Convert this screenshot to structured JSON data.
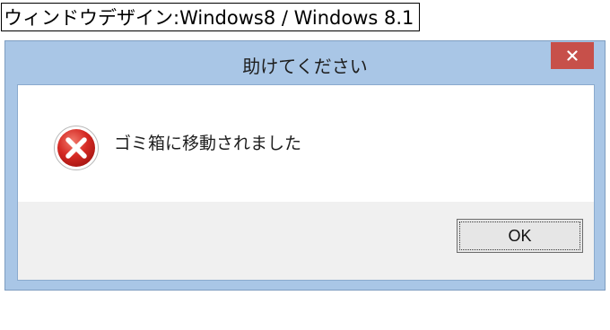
{
  "caption": "ウィンドウデザイン:Windows8 / Windows 8.1",
  "dialog": {
    "title": "助けてください",
    "message": "ゴミ箱に移動されました",
    "ok_label": "OK",
    "icons": {
      "close": "close-icon",
      "status": "error-icon"
    },
    "colors": {
      "frame": "#a9c6e6",
      "close_button": "#c7504a",
      "footer": "#f0f0f0",
      "error_icon": "#d12b2b"
    }
  }
}
